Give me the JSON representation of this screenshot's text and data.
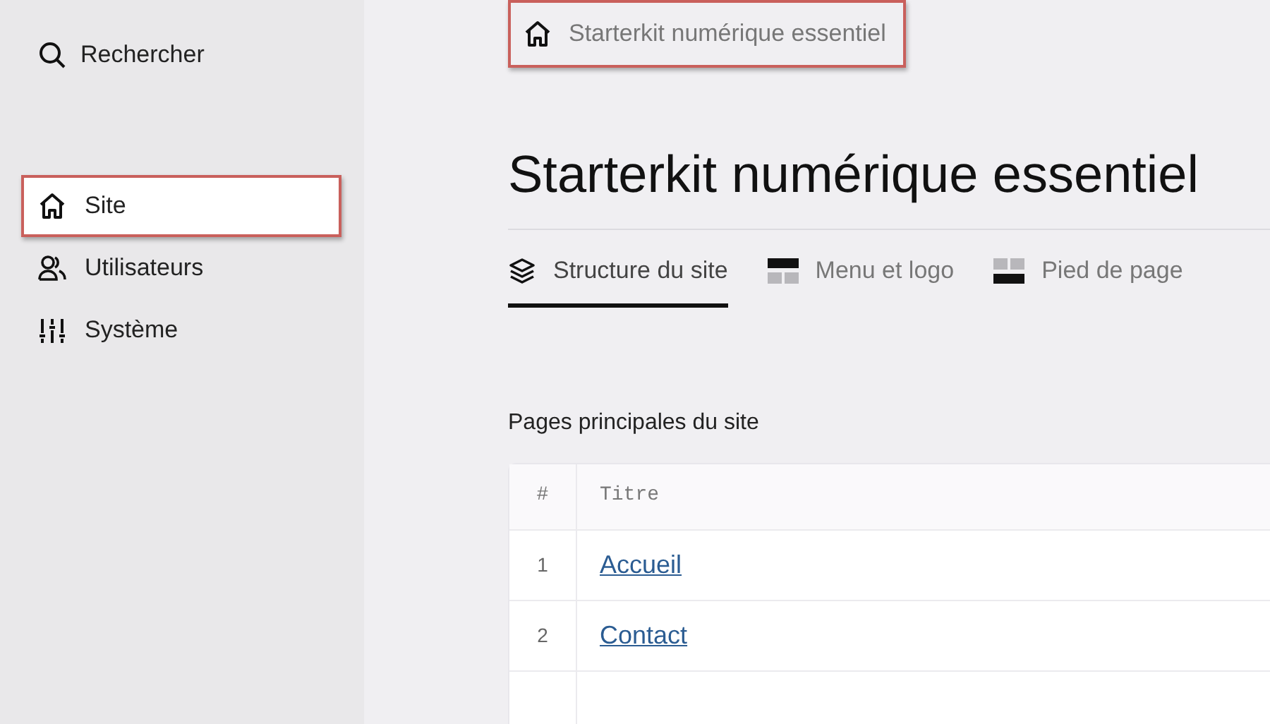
{
  "sidebar": {
    "search": {
      "label": "Rechercher"
    },
    "items": [
      {
        "kind": "site",
        "label": "Site",
        "selected": true,
        "highlighted": true
      },
      {
        "kind": "users",
        "label": "Utilisateurs",
        "selected": false,
        "highlighted": false
      },
      {
        "kind": "system",
        "label": "Système",
        "selected": false,
        "highlighted": false
      }
    ]
  },
  "breadcrumb": {
    "label": "Starterkit numérique essentiel",
    "highlighted": true
  },
  "title": "Starterkit numérique essentiel",
  "tabs": [
    {
      "kind": "layers",
      "label": "Structure du site",
      "selected": true
    },
    {
      "kind": "header",
      "label": "Menu et logo",
      "selected": false
    },
    {
      "kind": "footer",
      "label": "Pied de page",
      "selected": false
    }
  ],
  "section_title": "Pages principales du site",
  "table": {
    "columns": [
      "#",
      "Titre"
    ],
    "rows": [
      {
        "number": "1",
        "title": "Accueil"
      },
      {
        "number": "2",
        "title": "Contact"
      },
      {
        "number": "",
        "title": ""
      }
    ]
  }
}
